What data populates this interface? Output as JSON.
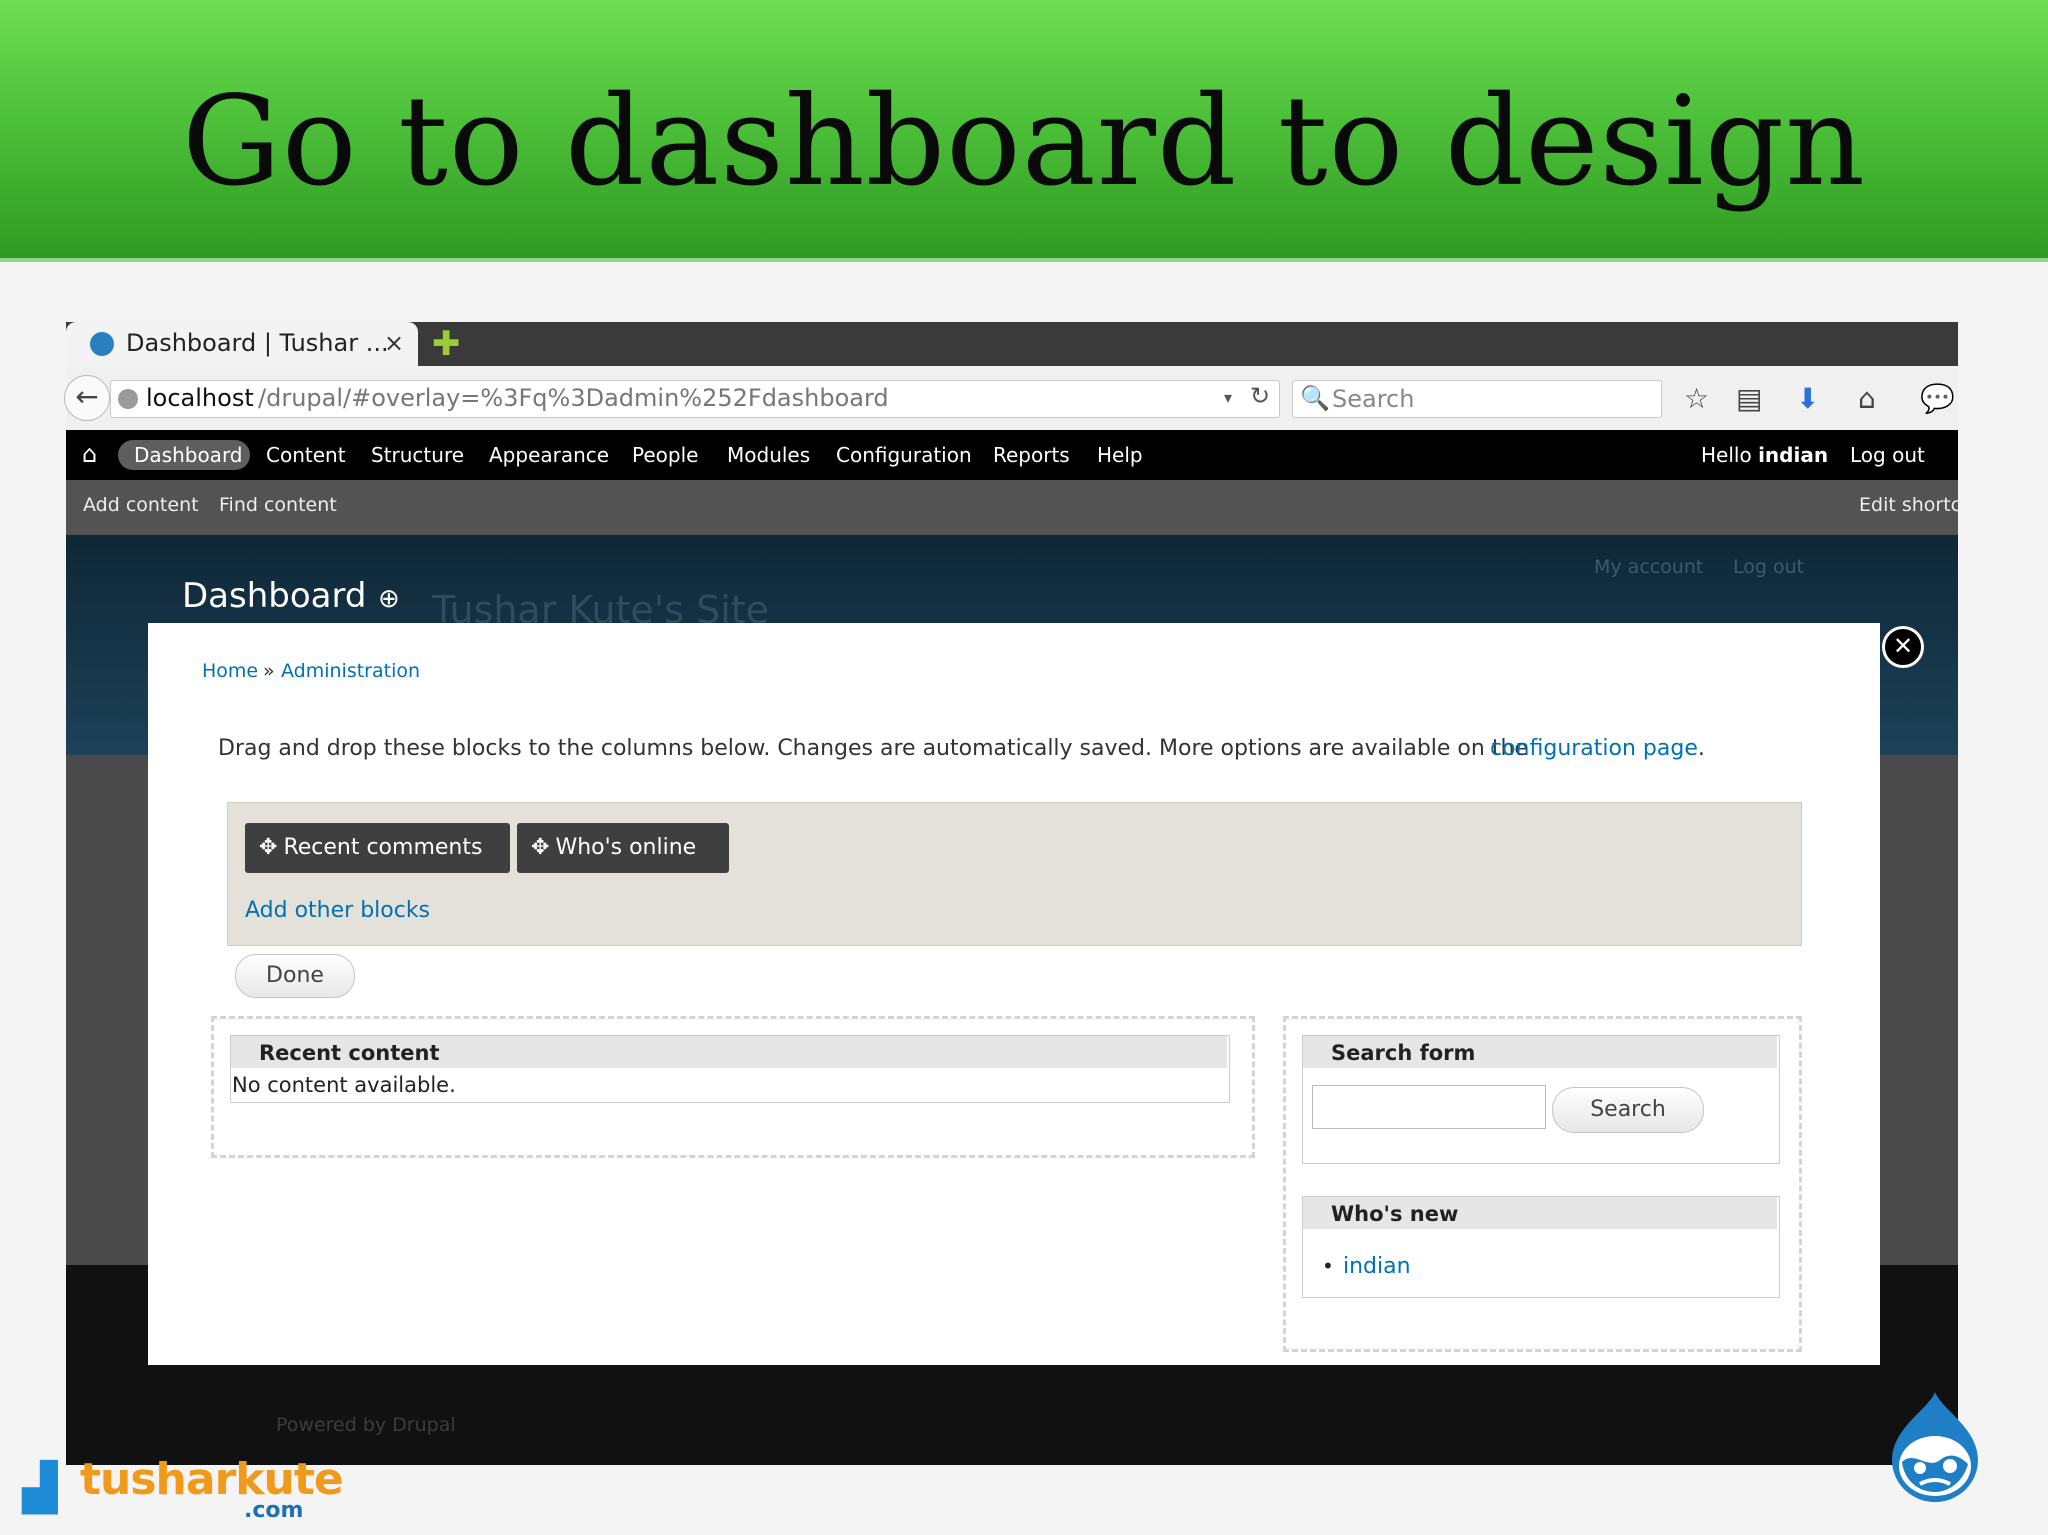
{
  "slide": {
    "title": "Go to dashboard to design"
  },
  "browser": {
    "tab_title": "Dashboard | Tushar ...",
    "tab_close": "×",
    "new_tab": "✚",
    "back": "←",
    "url_host": "localhost",
    "url_path": "/drupal/#overlay=%3Fq%3Dadmin%252Fdashboard",
    "url_drop": "▾",
    "reload": "↻",
    "search_placeholder": "Search",
    "icons": {
      "search": "🔍",
      "bookmark": "☆",
      "reader": "▤",
      "download": "⬇",
      "home": "⌂",
      "chat": "💬"
    }
  },
  "toolbar": {
    "home_icon": "⌂",
    "menu": [
      "Dashboard",
      "Content",
      "Structure",
      "Appearance",
      "People",
      "Modules",
      "Configuration",
      "Reports",
      "Help"
    ],
    "hello_prefix": "Hello ",
    "username": "indian",
    "logout": "Log out"
  },
  "shortcuts": {
    "add_content": "Add content",
    "find_content": "Find content",
    "edit_shortcuts": "Edit shortc"
  },
  "site": {
    "page_heading": "Dashboard",
    "add_icon": "⊕",
    "site_name": "Tushar Kute's Site",
    "my_account": "My account",
    "logout": "Log out",
    "powered": "Powered by Drupal"
  },
  "overlay": {
    "close": "✕",
    "breadcrumb": {
      "home": "Home",
      "sep": "»",
      "admin": "Administration"
    },
    "help_text": "Drag and drop these blocks to the columns below. Changes are automatically saved. More options are available on the",
    "config_link": "configuration page",
    "period": ".",
    "disabled_blocks": [
      "Recent comments",
      "Who's online"
    ],
    "move_icon": "✥",
    "add_other_blocks": "Add other blocks",
    "done": "Done",
    "recent_content": {
      "title": "Recent content",
      "body": "No content available."
    },
    "search_form": {
      "title": "Search form",
      "button": "Search"
    },
    "whos_new": {
      "title": "Who's new",
      "bullet": "•",
      "users": [
        "indian"
      ]
    }
  },
  "logos": {
    "brand_bars": "▟",
    "brand_name": "tusharkute",
    "brand_tld": ".com"
  }
}
